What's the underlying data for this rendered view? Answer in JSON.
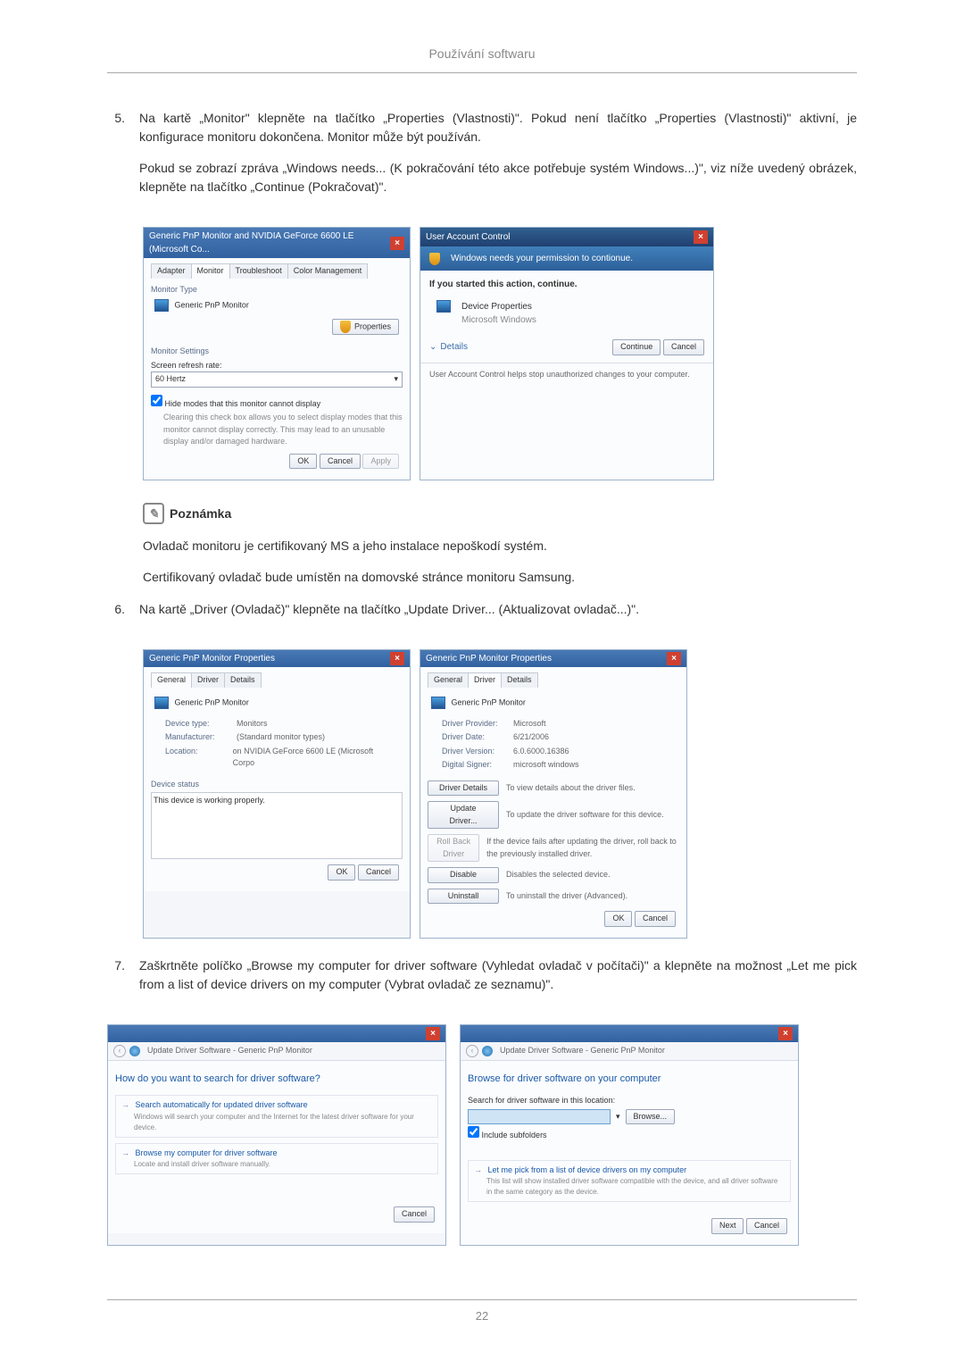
{
  "header": {
    "title": "Používání softwaru"
  },
  "step5": {
    "num": "5.",
    "p1": "Na kartě „Monitor\" klepněte na tlačítko „Properties (Vlastnosti)\". Pokud není tlačítko „Properties (Vlastnosti)\" aktivní, je konfigurace monitoru dokončena. Monitor může být používán.",
    "p2": "Pokud se zobrazí zpráva „Windows needs... (K pokračování této akce potřebuje systém Windows...)\", viz níže uvedený obrázek, klepněte na tlačítko „Continue (Pokračovat)\"."
  },
  "dlg1": {
    "title": "Generic PnP Monitor and NVIDIA GeForce 6600 LE (Microsoft Co...",
    "tabs": [
      "Adapter",
      "Monitor",
      "Troubleshoot",
      "Color Management"
    ],
    "monitorTypeLabel": "Monitor Type",
    "monitorType": "Generic PnP Monitor",
    "propertiesBtn": "Properties",
    "monitorSettings": "Monitor Settings",
    "refreshLabel": "Screen refresh rate:",
    "refreshValue": "60 Hertz",
    "hideModes": "Hide modes that this monitor cannot display",
    "hideDesc": "Clearing this check box allows you to select display modes that this monitor cannot display correctly. This may lead to an unusable display and/or damaged hardware.",
    "ok": "OK",
    "cancel": "Cancel",
    "apply": "Apply"
  },
  "uac": {
    "title": "User Account Control",
    "banner": "Windows needs your permission to contionue.",
    "started": "If you started this action, continue.",
    "item1": "Device Properties",
    "item2": "Microsoft Windows",
    "details": "Details",
    "continue": "Continue",
    "cancel": "Cancel",
    "footer": "User Account Control helps stop unauthorized changes to your computer."
  },
  "note": {
    "title": "Poznámka",
    "p1": "Ovladač monitoru je certifikovaný MS a jeho instalace nepoškodí systém.",
    "p2": "Certifikovaný ovladač bude umístěn na domovské stránce monitoru Samsung."
  },
  "step6": {
    "num": "6.",
    "p1": "Na kartě „Driver (Ovladač)\" klepněte na tlačítko „Update Driver... (Aktualizovat ovladač...)\"."
  },
  "dlg2": {
    "title": "Generic PnP Monitor Properties",
    "tabs": [
      "General",
      "Driver",
      "Details"
    ],
    "name": "Generic PnP Monitor",
    "deviceTypeLabel": "Device type:",
    "deviceType": "Monitors",
    "manufacturerLabel": "Manufacturer:",
    "manufacturer": "(Standard monitor types)",
    "locationLabel": "Location:",
    "location": "on NVIDIA GeForce 6600 LE (Microsoft Corpo",
    "statusLabel": "Device status",
    "statusText": "This device is working properly.",
    "ok": "OK",
    "cancel": "Cancel"
  },
  "dlg3": {
    "title": "Generic PnP Monitor Properties",
    "tabs": [
      "General",
      "Driver",
      "Details"
    ],
    "name": "Generic PnP Monitor",
    "providerLabel": "Driver Provider:",
    "provider": "Microsoft",
    "dateLabel": "Driver Date:",
    "date": "6/21/2006",
    "versionLabel": "Driver Version:",
    "version": "6.0.6000.16386",
    "signerLabel": "Digital Signer:",
    "signer": "microsoft windows",
    "driverDetails": "Driver Details",
    "driverDetailsDesc": "To view details about the driver files.",
    "updateDriver": "Update Driver...",
    "updateDriverDesc": "To update the driver software for this device.",
    "rollBack": "Roll Back Driver",
    "rollBackDesc": "If the device fails after updating the driver, roll back to the previously installed driver.",
    "disable": "Disable",
    "disableDesc": "Disables the selected device.",
    "uninstall": "Uninstall",
    "uninstallDesc": "To uninstall the driver (Advanced).",
    "ok": "OK",
    "cancel": "Cancel"
  },
  "step7": {
    "num": "7.",
    "p1": "Zaškrtněte políčko „Browse my computer for driver software (Vyhledat ovladač v počítači)\" a klepněte na možnost „Let me pick from a list of device drivers on my computer (Vybrat ovladač ze seznamu)\"."
  },
  "dlg4": {
    "breadcrumb": "Update Driver Software - Generic PnP Monitor",
    "heading": "How do you want to search for driver software?",
    "opt1": "Search automatically for updated driver software",
    "opt1desc": "Windows will search your computer and the Internet for the latest driver software for your device.",
    "opt2": "Browse my computer for driver software",
    "opt2desc": "Locate and install driver software manually.",
    "cancel": "Cancel"
  },
  "dlg5": {
    "breadcrumb": "Update Driver Software - Generic PnP Monitor",
    "heading": "Browse for driver software on your computer",
    "searchLabel": "Search for driver software in this location:",
    "browse": "Browse...",
    "include": "Include subfolders",
    "opt1": "Let me pick from a list of device drivers on my computer",
    "opt1desc": "This list will show installed driver software compatible with the device, and all driver software in the same category as the device.",
    "next": "Next",
    "cancel": "Cancel"
  },
  "pageNum": "22"
}
